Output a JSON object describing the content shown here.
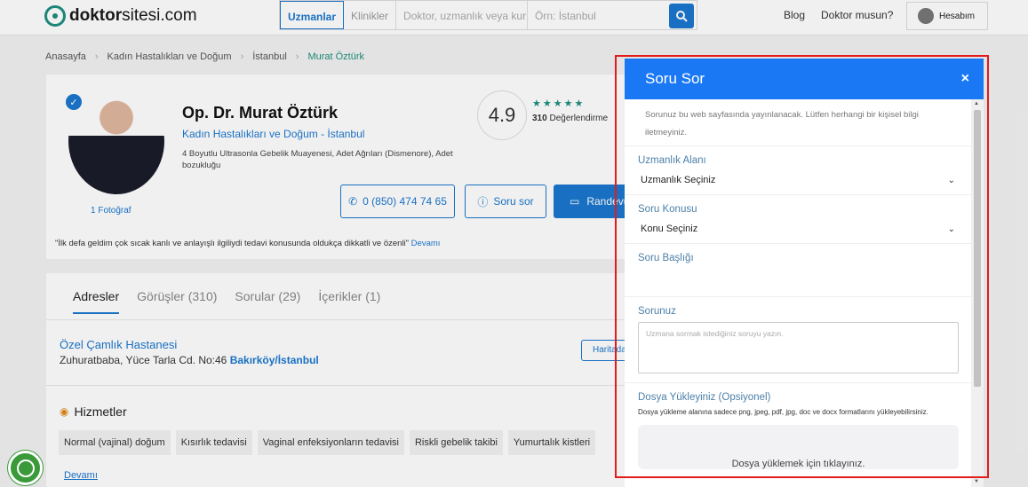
{
  "header": {
    "logo_bold": "doktor",
    "logo_light": "sitesi.com",
    "tab_doctors": "Uzmanlar",
    "tab_clinics": "Klinikler",
    "search_placeholder": "Doktor, uzmanlık veya kurı",
    "city_placeholder": "Örn: İstanbul",
    "blog": "Blog",
    "are_you_doctor": "Doktor musun?",
    "account": "Hesabım"
  },
  "breadcrumb": [
    "Anasayfa",
    "Kadın Hastalıkları ve Doğum",
    "İstanbul",
    "Murat Öztürk"
  ],
  "profile": {
    "name": "Op. Dr. Murat Öztürk",
    "specialty": "Kadın Hastalıkları ve Doğum - İstanbul",
    "description": "4 Boyutlu Ultrasonla Gebelik Muayenesi, Adet Ağrıları (Dismenore), Adet bozukluğu",
    "photo_count": "1 Fotoğraf",
    "rating": "4.9",
    "stars": "★★★★★",
    "rating_count_num": "310",
    "rating_count_label": "Değerlendirme",
    "phone": "0 (850) 474 74 65",
    "ask_button": "Soru sor",
    "appointment_button": "Randevu",
    "review_quote": "\"İlk defa geldim çok sıcak kanlı ve anlayışlı ilgiliydi tedavi konusunda oldukça dikkatli ve özenli\"",
    "review_more": "Devamı"
  },
  "tabs": [
    {
      "label": "Adresler",
      "active": true
    },
    {
      "label": "Görüşler (310)",
      "active": false
    },
    {
      "label": "Sorular (29)",
      "active": false
    },
    {
      "label": "İçerikler (1)",
      "active": false
    }
  ],
  "clinic": {
    "name": "Özel Çamlık Hastanesi",
    "address": "Zuhuratbaba, Yüce Tarla Cd. No:46",
    "district": "Bakırköy",
    "city": "/İstanbul",
    "map_button": "Haritada"
  },
  "services": {
    "title": "Hizmetler",
    "items": [
      "Normal (vajinal) doğum",
      "Kısırlık tedavisi",
      "Vaginal enfeksiyonların tedavisi",
      "Riskli gebelik takibi",
      "Yumurtalık kistleri"
    ],
    "more": "Devamı"
  },
  "modal": {
    "title": "Soru Sor",
    "close": "×",
    "notice": "Sorunuz bu web sayfasında yayınlanacak. Lütfen herhangi bir kişisel bilgi iletmeyiniz.",
    "specialty_label": "Uzmanlık Alanı",
    "specialty_value": "Uzmanlık Seçiniz",
    "topic_label": "Soru Konusu",
    "topic_value": "Konu Seçiniz",
    "subject_label": "Soru Başlığı",
    "question_label": "Sorunuz",
    "question_placeholder": "Uzmana sormak istediğiniz soruyu yazın.",
    "upload_label": "Dosya Yükleyiniz (Opsiyonel)",
    "upload_note": "Dosya yükleme alanına sadece png, jpeg, pdf, jpg, doc ve docx formatlarını yükleyebilirsiniz.",
    "upload_cta": "Dosya yüklemek için tıklayınız."
  }
}
